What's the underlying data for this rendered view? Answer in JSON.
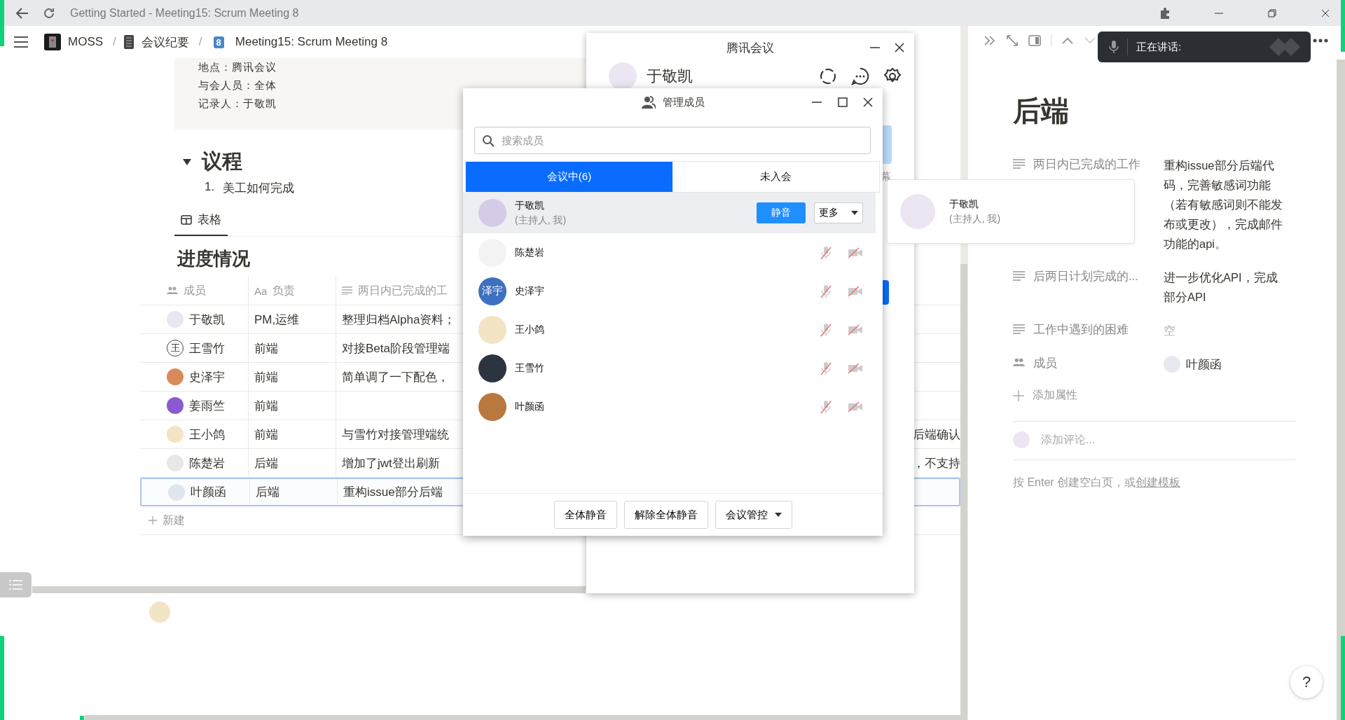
{
  "browser": {
    "title": "Getting Started - Meeting15: Scrum Meeting 8"
  },
  "breadcrumb": {
    "separator": "/",
    "items": [
      {
        "label": "MOSS",
        "kind": "logo"
      },
      {
        "label": "会议纪要",
        "kind": "notebook"
      },
      {
        "label": "Meeting15: Scrum Meeting 8",
        "kind": "badge",
        "icon_text": "8"
      }
    ]
  },
  "callout": {
    "lines": [
      "地点：腾讯会议",
      "与会人员：全体",
      "记录人：于敬凯"
    ]
  },
  "agenda": {
    "heading": "议程",
    "expanded": true,
    "items": [
      {
        "number": "1.",
        "text": "美工如何完成"
      }
    ]
  },
  "views": [
    {
      "label": "表格",
      "selected": true
    }
  ],
  "table": {
    "title": "进度情况",
    "columns": [
      {
        "kind": "person",
        "label": "成员"
      },
      {
        "kind": "text",
        "icon_text": "Aa",
        "label": "负责"
      },
      {
        "kind": "rich",
        "label": "两日内已完成的工"
      }
    ],
    "rows": [
      {
        "member": "于敬凯",
        "role": "PM,运维",
        "done": "整理归档Alpha资料；",
        "selected": false
      },
      {
        "member": "王雪竹",
        "avatar_text": "王",
        "role": "前端",
        "done": "对接Beta阶段管理端",
        "selected": false
      },
      {
        "member": "史泽宇",
        "role": "前端",
        "done": "简单调了一下配色，",
        "selected": false
      },
      {
        "member": "姜雨竺",
        "role": "前端",
        "selected": false
      },
      {
        "member": "王小鸽",
        "role": "前端",
        "done": "与雪竹对接管理端统",
        "tail": "后端确认",
        "selected": false
      },
      {
        "member": "陈楚岩",
        "role": "后端",
        "done": "增加了jwt登出刷新",
        "tail": "，不支持",
        "selected": false
      },
      {
        "member": "叶颜函",
        "role": "后端",
        "done": "重构issue部分后端",
        "selected": true
      }
    ],
    "new_row": "新建"
  },
  "detail_panel": {
    "speaking": "正在讲话:",
    "title": "后端",
    "properties": [
      {
        "kind": "text",
        "name": "两日内已完成的工作",
        "value": "重构issue部分后端代码，完善敏感词功能（若有敏感词则不能发布或更改），完成邮件功能的api。",
        "empty": false
      },
      {
        "kind": "text",
        "name": "后两日计划完成的...",
        "value": "进一步优化API，完成部分API",
        "empty": false
      },
      {
        "kind": "text",
        "name": "工作中遇到的困难",
        "value": "空",
        "empty": true
      },
      {
        "kind": "person",
        "name": "成员",
        "value": "叶颜函",
        "empty": false
      }
    ],
    "add_property": "添加属性",
    "comment_placeholder": "添加评论...",
    "hint": "按 Enter 创建空白页，或",
    "hint_link": "创建模板"
  },
  "meeting": {
    "title": "腾讯会议",
    "user": "于敬凯",
    "fragment": "幕"
  },
  "members_dialog": {
    "title": "管理成员",
    "search_placeholder": "搜索成员",
    "tabs": [
      {
        "label": "会议中(6)",
        "selected": true
      },
      {
        "label": "未入会",
        "selected": false
      }
    ],
    "members": [
      {
        "name": "于敬凯",
        "note": "(主持人, 我)",
        "selected": true
      },
      {
        "name": "陈楚岩",
        "selected": false
      },
      {
        "name": "史泽宇",
        "avatar_text": "泽宇",
        "selected": false
      },
      {
        "name": "王小鸽",
        "selected": false
      },
      {
        "name": "王雪竹",
        "selected": false
      },
      {
        "name": "叶颜函",
        "selected": false
      }
    ],
    "mute_label": "静音",
    "more_label": "更多",
    "footer": [
      {
        "label": "全体静音",
        "kind": "button"
      },
      {
        "label": "解除全体静音",
        "kind": "button"
      },
      {
        "label": "会议管控",
        "kind": "dropdown"
      }
    ]
  },
  "member_card": {
    "name": "于敬凯",
    "note": "(主持人, 我)"
  },
  "help": "?"
}
